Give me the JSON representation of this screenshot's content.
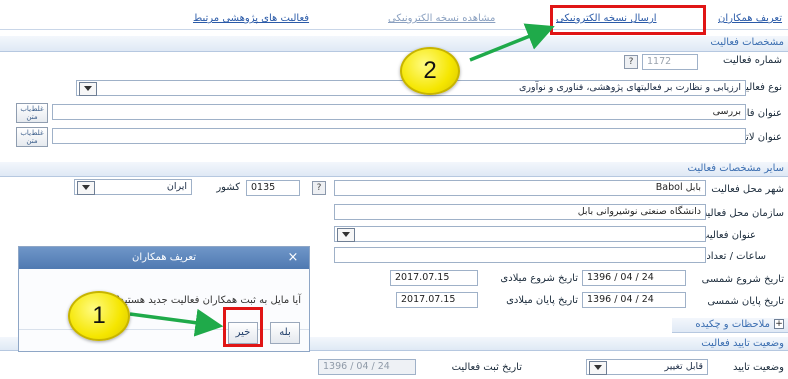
{
  "top_links": {
    "define_colleagues": "تعریف همکاران",
    "send_electronic_copy": "ارسال نسخه الکترونیکی",
    "view_electronic_copy": "مشاهده نسخه الکترونیکی",
    "related_research_activities": "فعالیت های پژوهشی مرتبط"
  },
  "sections": {
    "activity_specs": "مشخصات فعالیت",
    "other_specs": "سایر مشخصات فعالیت",
    "notes_abstract": "ملاحظات و چکیده",
    "approval_status_section": "وضعیت تایید فعالیت"
  },
  "form": {
    "activity_number_label": "شماره فعالیت",
    "activity_number_value": "1172",
    "activity_type_label": "نوع فعالیت",
    "activity_type_value": "ارزیابی و نظارت بر فعالیتهای پژوهشی، فناوری و نوآوری",
    "persian_title_label": "عنوان فارسی",
    "persian_title_value": "بررسی",
    "latin_title_label": "عنوان لاتین",
    "latin_title_value": "",
    "city_label": "شهر محل فعالیت",
    "city_value": "بابل Babol",
    "country_label": "کشور",
    "country_code": "0135",
    "country_value": "ایران",
    "org_label": "سازمان محل فعالیت",
    "org_value": "دانشگاه صنعتی نوشیروانی بابل",
    "activity_title_label": "عنوان فعالیت",
    "hours_label": "ساعات / تعداد",
    "start_shamsi_label": "تاریخ شروع شمسی",
    "start_shamsi_value": "1396 / 04 / 24",
    "start_gregorian_label": "تاریخ شروع میلادی",
    "start_gregorian_value": "2017.07.15",
    "end_shamsi_label": "تاریخ پایان شمسی",
    "end_shamsi_value": "1396 / 04 / 24",
    "end_gregorian_label": "تاریخ پایان میلادی",
    "end_gregorian_value": "2017.07.15",
    "approval_status_label": "وضعیت تایید",
    "approval_status_value": "قابل تغییر",
    "registration_date_label": "تاریخ ثبت فعالیت",
    "registration_date_value": "1396 / 04 / 24"
  },
  "spell_button": {
    "line1": "غلط‌یاب",
    "line2": "متن"
  },
  "help_button": "?",
  "expand_icon": "+",
  "dialog": {
    "title": "تعریف همکاران",
    "close": "×",
    "message": "آیا مایل به ثبت همکاران فعالیت جدید هستید؟",
    "yes": "بله",
    "no": "خیر"
  },
  "annotations": {
    "step1": "1",
    "step2": "2",
    "arrow_color": "#1faa4a",
    "highlight_color": "#e01515",
    "bubble_color": "#f5e600"
  }
}
